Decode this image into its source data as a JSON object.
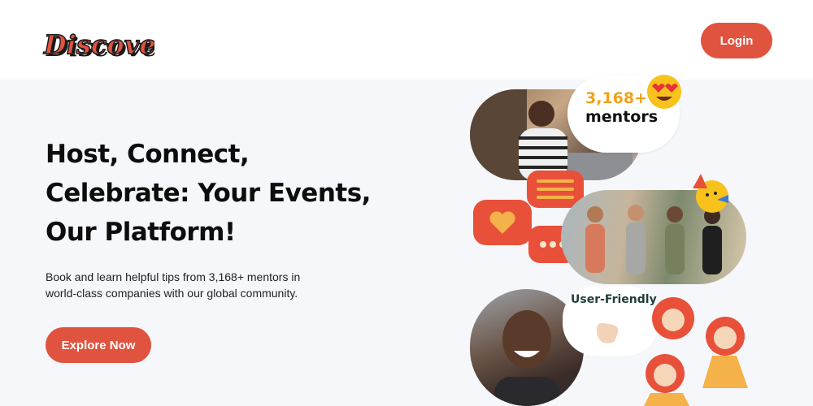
{
  "header": {
    "logo_text": "Discover",
    "login_label": "Login"
  },
  "hero": {
    "headline_lines": [
      "Host, Connect,",
      "Celebrate: Your Events,",
      "Our Platform!"
    ],
    "subtext_lines": [
      "Book and learn helpful tips from 3,168+ mentors in",
      "world-class companies with our global community."
    ],
    "cta_label": "Explore Now"
  },
  "collage": {
    "mentors_count": "3,168+",
    "mentors_label": "mentors",
    "friendly_label": "User-Friendly"
  },
  "icons": {
    "heart_eyes": "heart-eyes-emoji-icon",
    "party": "party-emoji-icon",
    "heart_chat": "heart-chat-icon",
    "lines_chat": "message-lines-icon",
    "dots_chat": "typing-dots-icon",
    "hand": "call-me-hand-icon"
  },
  "colors": {
    "accent": "#e0533f",
    "mentors_count": "#f0a21a",
    "background": "#f6f7fb"
  }
}
